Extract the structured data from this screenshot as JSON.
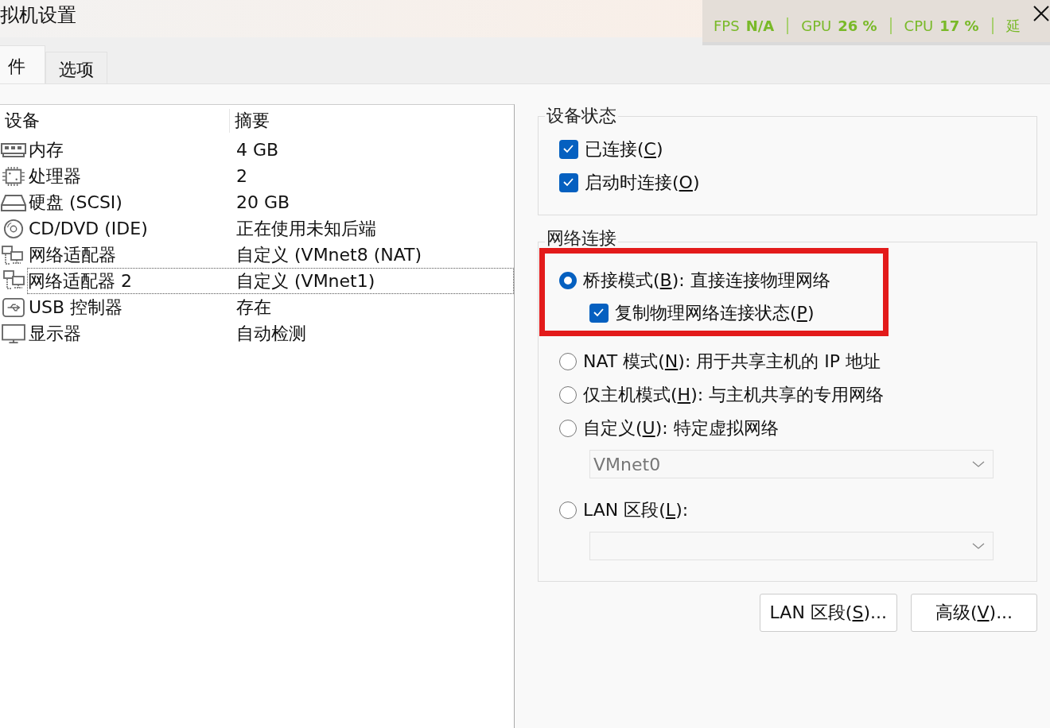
{
  "window": {
    "title": "拟机设置"
  },
  "tabs": [
    {
      "label": "件",
      "selected": true
    },
    {
      "label": "选项",
      "selected": false
    }
  ],
  "devices": {
    "columns": [
      "设备",
      "摘要"
    ],
    "rows": [
      {
        "kind": "memory",
        "device": "内存",
        "summary": "4 GB",
        "selected": false
      },
      {
        "kind": "processor",
        "device": "处理器",
        "summary": "2",
        "selected": false
      },
      {
        "kind": "disk",
        "device": "硬盘 (SCSI)",
        "summary": "20 GB",
        "selected": false
      },
      {
        "kind": "cd",
        "device": "CD/DVD (IDE)",
        "summary": "正在使用未知后端",
        "selected": false
      },
      {
        "kind": "network",
        "device": "网络适配器",
        "summary": "自定义 (VMnet8 (NAT)",
        "selected": false
      },
      {
        "kind": "network",
        "device": "网络适配器 2",
        "summary": "自定义 (VMnet1)",
        "selected": true
      },
      {
        "kind": "usb",
        "device": "USB 控制器",
        "summary": "存在",
        "selected": false
      },
      {
        "kind": "display",
        "device": "显示器",
        "summary": "自动检测",
        "selected": false
      }
    ]
  },
  "device_status": {
    "title": "设备状态",
    "options": [
      {
        "before": "已连接(",
        "key": "C",
        "after": ")",
        "checked": true
      },
      {
        "before": "启动时连接(",
        "key": "O",
        "after": ")",
        "checked": true
      }
    ]
  },
  "network_connection": {
    "title": "网络连接",
    "items": [
      {
        "kind": "radio",
        "before": "桥接模式(",
        "key": "B",
        "after": "): 直接连接物理网络",
        "selected": true
      },
      {
        "kind": "checkbox",
        "before": "复制物理网络连接状态(",
        "key": "P",
        "after": ")",
        "checked": true
      },
      {
        "kind": "radio",
        "before": "NAT 模式(",
        "key": "N",
        "after": "): 用于共享主机的 IP 地址",
        "selected": false
      },
      {
        "kind": "radio",
        "before": "仅主机模式(",
        "key": "H",
        "after": "): 与主机共享的专用网络",
        "selected": false
      },
      {
        "kind": "radio",
        "before": "自定义(",
        "key": "U",
        "after": "): 特定虚拟网络",
        "selected": false
      },
      {
        "kind": "dropdown",
        "value": "VMnet0",
        "disabled": true
      },
      {
        "kind": "radio",
        "before": "LAN 区段(",
        "key": "L",
        "after": "):",
        "selected": false
      },
      {
        "kind": "dropdown",
        "disabled": true
      }
    ]
  },
  "buttons": [
    {
      "before": "LAN 区段(",
      "key": "S",
      "after": ")..."
    },
    {
      "before": "高级(",
      "key": "V",
      "after": ")..."
    }
  ],
  "performance_overlay": {
    "metrics": [
      {
        "name": "FPS",
        "value": "N/A"
      },
      {
        "name": "GPU",
        "value": "26 %"
      },
      {
        "name": "CPU",
        "value": "17 %"
      }
    ],
    "cut_label": "延"
  }
}
